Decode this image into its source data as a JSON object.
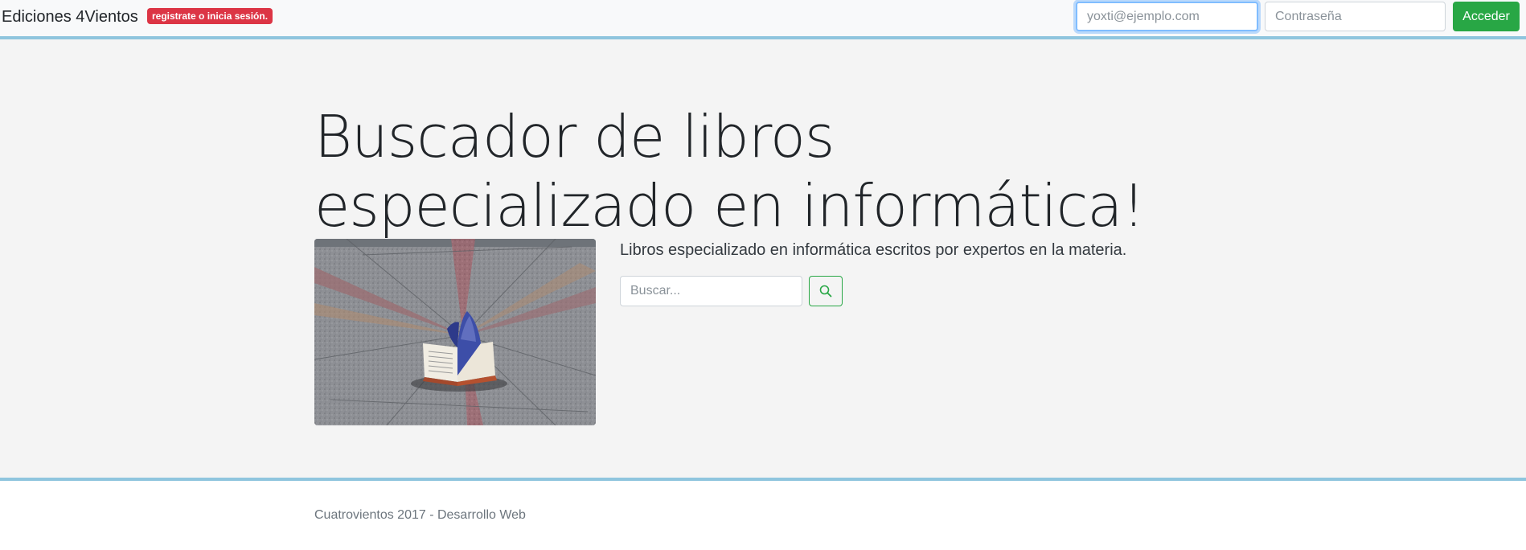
{
  "navbar": {
    "brand": "Ediciones 4Vientos",
    "badge": "registrate o inicia sesión.",
    "email_placeholder": "yoxti@ejemplo.com",
    "password_placeholder": "Contraseña",
    "login_label": "Acceder"
  },
  "hero": {
    "title": "Buscador de libros especializado en informática!",
    "lead": "Libros especializado en informática escritos por expertos en la materia.",
    "search_placeholder": "Buscar...",
    "search_icon": "search-icon",
    "image": "open-book-on-stone-plaza"
  },
  "footer": {
    "text": "Cuatrovientos 2017 - Desarrollo Web"
  },
  "colors": {
    "navbar_bg": "#f8f9fa",
    "badge_bg": "#dc3545",
    "accent_green": "#28a745",
    "divider_blue": "#8fc5de",
    "jumbotron_bg": "#f4f4f4",
    "focus_blue": "#80bdff"
  }
}
